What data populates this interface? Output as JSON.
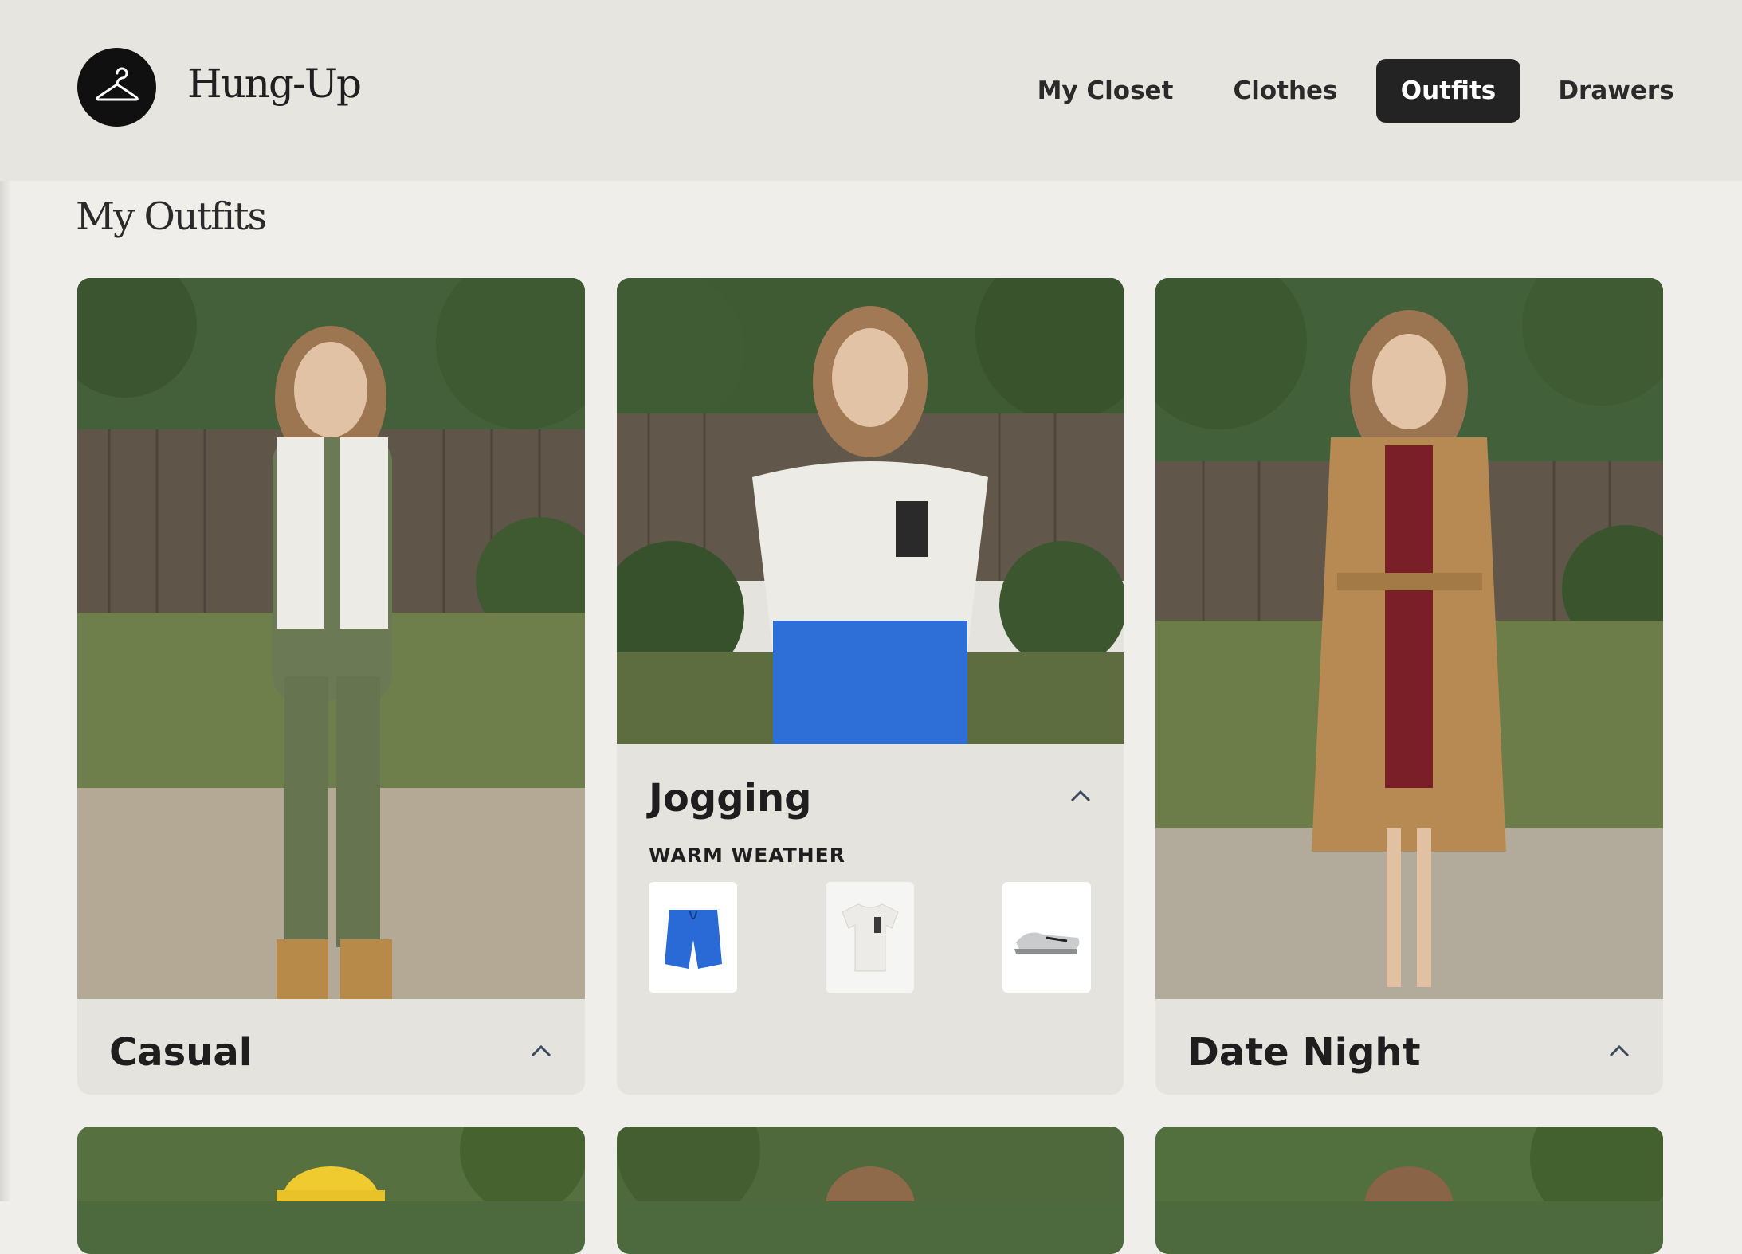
{
  "app": {
    "name": "Hung-Up",
    "logo_icon": "hanger-icon"
  },
  "nav": {
    "items": [
      {
        "label": "My Closet",
        "active": false
      },
      {
        "label": "Clothes",
        "active": false
      },
      {
        "label": "Outfits",
        "active": true
      },
      {
        "label": "Drawers",
        "active": false
      }
    ]
  },
  "page": {
    "title": "My Outfits"
  },
  "outfits": [
    {
      "name": "Casual",
      "expanded": false
    },
    {
      "name": "Jogging",
      "expanded": true,
      "tag": "WARM WEATHER",
      "items": [
        "blue-shorts-thumbnail",
        "white-tshirt-thumbnail",
        "sneakers-thumbnail"
      ]
    },
    {
      "name": "Date Night",
      "expanded": false
    }
  ],
  "colors": {
    "background": "#efeeea",
    "header": "#e7e5e0",
    "card": "#e5e3dd",
    "active_nav": "#232323"
  }
}
